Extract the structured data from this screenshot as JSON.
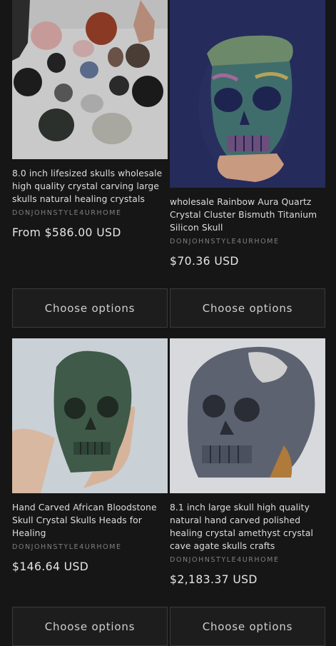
{
  "products": [
    {
      "title": "8.0 inch lifesized skulls wholesale high quality crystal carving large skulls natural healing crystals",
      "vendor": "DONJOHNSTYLE4URHOME",
      "price": "From $586.00 USD",
      "button": "Choose options"
    },
    {
      "title": "wholesale Rainbow Aura Quartz Crystal Cluster Bismuth Titanium Silicon Skull",
      "vendor": "DONJOHNSTYLE4URHOME",
      "price": "$70.36 USD",
      "button": "Choose options"
    },
    {
      "title": "Hand Carved African Bloodstone Skull Crystal Skulls Heads for Healing",
      "vendor": "DONJOHNSTYLE4URHOME",
      "price": "$146.64 USD",
      "button": "Choose options"
    },
    {
      "title": "8.1 inch large skull high quality natural hand carved polished healing crystal amethyst crystal cave agate skulls crafts",
      "vendor": "DONJOHNSTYLE4URHOME",
      "price": "$2,183.37 USD",
      "button": "Choose options"
    }
  ]
}
